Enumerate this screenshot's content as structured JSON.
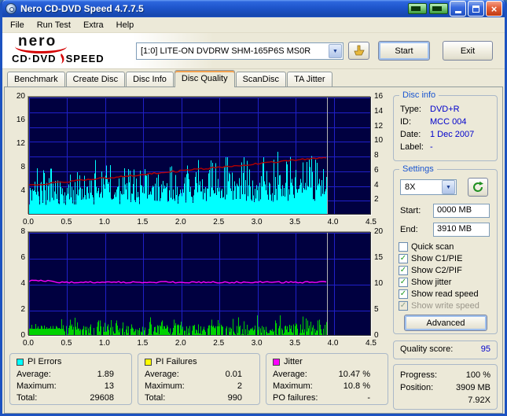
{
  "window": {
    "title": "Nero CD-DVD Speed 4.7.7.5"
  },
  "menu": {
    "items": [
      "File",
      "Run Test",
      "Extra",
      "Help"
    ]
  },
  "logo": {
    "line1": "nero",
    "line2_left": "CD·DVD",
    "line2_right": "SPEED"
  },
  "toolbar": {
    "drive": "[1:0]  LITE-ON DVDRW SHM-165P6S MS0R",
    "start_label": "Start",
    "exit_label": "Exit"
  },
  "tabs": [
    {
      "label": "Benchmark",
      "active": false
    },
    {
      "label": "Create Disc",
      "active": false
    },
    {
      "label": "Disc Info",
      "active": false
    },
    {
      "label": "Disc Quality",
      "active": true
    },
    {
      "label": "ScanDisc",
      "active": false
    },
    {
      "label": "TA Jitter",
      "active": false
    }
  ],
  "disc_info": {
    "title": "Disc info",
    "rows": [
      [
        "Type:",
        "DVD+R"
      ],
      [
        "ID:",
        "MCC 004"
      ],
      [
        "Date:",
        "1 Dec 2007"
      ],
      [
        "Label:",
        "-"
      ]
    ]
  },
  "settings": {
    "title": "Settings",
    "speed_value": "8X",
    "start_label": "Start:",
    "start_value": "0000 MB",
    "end_label": "End:",
    "end_value": "3910 MB",
    "checkboxes": [
      {
        "label": "Quick scan",
        "checked": false,
        "disabled": false
      },
      {
        "label": "Show C1/PIE",
        "checked": true,
        "disabled": false
      },
      {
        "label": "Show C2/PIF",
        "checked": true,
        "disabled": false
      },
      {
        "label": "Show jitter",
        "checked": true,
        "disabled": false
      },
      {
        "label": "Show read speed",
        "checked": true,
        "disabled": false
      },
      {
        "label": "Show write speed",
        "checked": true,
        "disabled": true
      }
    ],
    "advanced_label": "Advanced"
  },
  "quality": {
    "label": "Quality score:",
    "value": "95"
  },
  "progress": {
    "rows": [
      [
        "Progress:",
        "100 %"
      ],
      [
        "Position:",
        "3909 MB"
      ],
      [
        "",
        "7.92X"
      ]
    ]
  },
  "stats": [
    {
      "title": "PI Errors",
      "color": "#00ffff",
      "rows": [
        [
          "Average:",
          "1.89"
        ],
        [
          "Maximum:",
          "13"
        ],
        [
          "Total:",
          "29608"
        ]
      ]
    },
    {
      "title": "PI Failures",
      "color": "#ffff00",
      "rows": [
        [
          "Average:",
          "0.01"
        ],
        [
          "Maximum:",
          "2"
        ],
        [
          "Total:",
          "990"
        ]
      ]
    },
    {
      "title": "Jitter",
      "color": "#ff00ff",
      "rows": [
        [
          "Average:",
          "10.47 %"
        ],
        [
          "Maximum:",
          "10.8 %"
        ],
        [
          "PO failures:",
          "-"
        ]
      ]
    }
  ],
  "chart_data": [
    {
      "type": "area",
      "name": "PI Errors / Read speed",
      "x_ticks": [
        0,
        0.5,
        1,
        1.5,
        2,
        2.5,
        3,
        3.5,
        4,
        4.5
      ],
      "x_tick_labels": [
        "0.0",
        "0.5",
        "1.0",
        "1.5",
        "2.0",
        "2.5",
        "3.0",
        "3.5",
        "4.0",
        "4.5"
      ],
      "x_range": [
        0,
        4.5
      ],
      "left_axis": {
        "range": [
          0,
          20
        ],
        "ticks": [
          4,
          8,
          12,
          16,
          20
        ]
      },
      "right_axis": {
        "range": [
          0,
          16
        ],
        "ticks": [
          2,
          4,
          6,
          8,
          10,
          12,
          14,
          16
        ]
      },
      "data_end_x": 3.91,
      "background": "#000040",
      "grid_color": "#2020c8",
      "series": [
        {
          "name": "PI Errors",
          "type": "spikes",
          "color": "#00ffff",
          "axis": "left",
          "average": 1.89,
          "maximum": 13
        },
        {
          "name": "Read speed",
          "type": "line",
          "color": "#b40000",
          "axis": "right",
          "start_value": 4.1,
          "end_value": 7.92
        }
      ],
      "end_marker": {
        "x": 3.91,
        "color": "#b4b4b4"
      }
    },
    {
      "type": "area",
      "name": "PI Failures / Jitter",
      "x_ticks": [
        0,
        0.5,
        1,
        1.5,
        2,
        2.5,
        3,
        3.5,
        4,
        4.5
      ],
      "x_tick_labels": [
        "0.0",
        "0.5",
        "1.0",
        "1.5",
        "2.0",
        "2.5",
        "3.0",
        "3.5",
        "4.0",
        "4.5"
      ],
      "x_range": [
        0,
        4.5
      ],
      "left_axis": {
        "range": [
          0,
          8
        ],
        "ticks": [
          0,
          2,
          4,
          6,
          8
        ]
      },
      "right_axis": {
        "range": [
          0,
          20
        ],
        "ticks": [
          0,
          5,
          10,
          15,
          20
        ]
      },
      "data_end_x": 3.91,
      "background": "#000040",
      "grid_color": "#2020c8",
      "series": [
        {
          "name": "PI Failures",
          "type": "spikes",
          "color": "#00d200",
          "axis": "left",
          "average": 0.01,
          "maximum": 2
        },
        {
          "name": "Jitter",
          "type": "line",
          "color": "#ff00ff",
          "axis": "right",
          "average": 10.47,
          "maximum": 10.8
        }
      ],
      "start_block": {
        "x0": 0,
        "x1": 0.46,
        "value_height": 0.6,
        "color": "#00d200"
      },
      "end_marker": {
        "x": 3.91,
        "color": "#b4b4b4"
      }
    }
  ]
}
